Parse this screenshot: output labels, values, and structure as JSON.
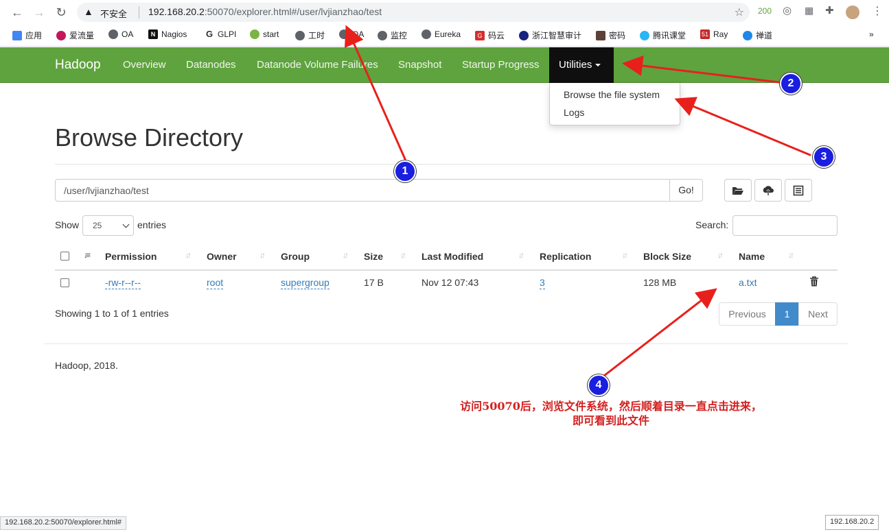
{
  "browser": {
    "insecure_label": "不安全",
    "url_host": "192.168.20.2",
    "url_rest": ":50070/explorer.html#/user/lvjianzhao/test",
    "ext_badge": "200",
    "bookmarks": [
      "应用",
      "爱流量",
      "OA",
      "Nagios",
      "GLPI",
      "start",
      "工时",
      "QA",
      "监控",
      "Eureka",
      "码云",
      "浙江智慧审计",
      "密码",
      "腾讯课堂",
      "Ray",
      "禅道"
    ],
    "more": "»"
  },
  "navbar": {
    "brand": "Hadoop",
    "items": [
      "Overview",
      "Datanodes",
      "Datanode Volume Failures",
      "Snapshot",
      "Startup Progress"
    ],
    "utilities": "Utilities",
    "dropdown": [
      "Browse the file system",
      "Logs"
    ]
  },
  "page": {
    "title": "Browse Directory",
    "path_value": "/user/lvjianzhao/test",
    "go_label": "Go!",
    "show_label": "Show",
    "entries_value": "25",
    "entries_label": "entries",
    "search_label": "Search:"
  },
  "table": {
    "headers": [
      "Permission",
      "Owner",
      "Group",
      "Size",
      "Last Modified",
      "Replication",
      "Block Size",
      "Name"
    ],
    "rows": [
      {
        "permission": "-rw-r--r--",
        "owner": "root",
        "group": "supergroup",
        "size": "17 B",
        "modified": "Nov 12 07:43",
        "replication": "3",
        "block_size": "128 MB",
        "name": "a.txt"
      }
    ],
    "showing": "Showing 1 to 1 of 1 entries",
    "pager": {
      "previous": "Previous",
      "current": "1",
      "next": "Next"
    }
  },
  "footer": "Hadoop, 2018.",
  "status": {
    "left": "192.168.20.2:50070/explorer.html#",
    "right": "192.168.20.2"
  },
  "annotations": {
    "badges": [
      "1",
      "2",
      "3",
      "4"
    ],
    "note_line1": "访问50070后，浏览文件系统，然后顺着目录一直点击进来，",
    "note_line2": "即可看到此文件",
    "arrow_color": "#e8201c",
    "badge_color": "#1a1ee0"
  },
  "colors": {
    "navbar": "#5fa33e",
    "link": "#337ab7",
    "active_page": "#428bca"
  }
}
